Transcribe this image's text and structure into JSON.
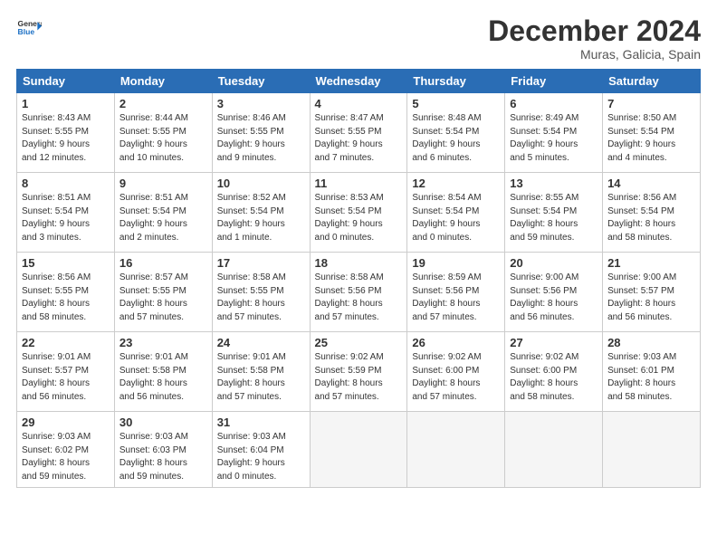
{
  "logo": {
    "line1": "General",
    "line2": "Blue"
  },
  "title": "December 2024",
  "location": "Muras, Galicia, Spain",
  "weekdays": [
    "Sunday",
    "Monday",
    "Tuesday",
    "Wednesday",
    "Thursday",
    "Friday",
    "Saturday"
  ],
  "weeks": [
    [
      {
        "day": "1",
        "info": "Sunrise: 8:43 AM\nSunset: 5:55 PM\nDaylight: 9 hours\nand 12 minutes."
      },
      {
        "day": "2",
        "info": "Sunrise: 8:44 AM\nSunset: 5:55 PM\nDaylight: 9 hours\nand 10 minutes."
      },
      {
        "day": "3",
        "info": "Sunrise: 8:46 AM\nSunset: 5:55 PM\nDaylight: 9 hours\nand 9 minutes."
      },
      {
        "day": "4",
        "info": "Sunrise: 8:47 AM\nSunset: 5:55 PM\nDaylight: 9 hours\nand 7 minutes."
      },
      {
        "day": "5",
        "info": "Sunrise: 8:48 AM\nSunset: 5:54 PM\nDaylight: 9 hours\nand 6 minutes."
      },
      {
        "day": "6",
        "info": "Sunrise: 8:49 AM\nSunset: 5:54 PM\nDaylight: 9 hours\nand 5 minutes."
      },
      {
        "day": "7",
        "info": "Sunrise: 8:50 AM\nSunset: 5:54 PM\nDaylight: 9 hours\nand 4 minutes."
      }
    ],
    [
      {
        "day": "8",
        "info": "Sunrise: 8:51 AM\nSunset: 5:54 PM\nDaylight: 9 hours\nand 3 minutes."
      },
      {
        "day": "9",
        "info": "Sunrise: 8:51 AM\nSunset: 5:54 PM\nDaylight: 9 hours\nand 2 minutes."
      },
      {
        "day": "10",
        "info": "Sunrise: 8:52 AM\nSunset: 5:54 PM\nDaylight: 9 hours\nand 1 minute."
      },
      {
        "day": "11",
        "info": "Sunrise: 8:53 AM\nSunset: 5:54 PM\nDaylight: 9 hours\nand 0 minutes."
      },
      {
        "day": "12",
        "info": "Sunrise: 8:54 AM\nSunset: 5:54 PM\nDaylight: 9 hours\nand 0 minutes."
      },
      {
        "day": "13",
        "info": "Sunrise: 8:55 AM\nSunset: 5:54 PM\nDaylight: 8 hours\nand 59 minutes."
      },
      {
        "day": "14",
        "info": "Sunrise: 8:56 AM\nSunset: 5:54 PM\nDaylight: 8 hours\nand 58 minutes."
      }
    ],
    [
      {
        "day": "15",
        "info": "Sunrise: 8:56 AM\nSunset: 5:55 PM\nDaylight: 8 hours\nand 58 minutes."
      },
      {
        "day": "16",
        "info": "Sunrise: 8:57 AM\nSunset: 5:55 PM\nDaylight: 8 hours\nand 57 minutes."
      },
      {
        "day": "17",
        "info": "Sunrise: 8:58 AM\nSunset: 5:55 PM\nDaylight: 8 hours\nand 57 minutes."
      },
      {
        "day": "18",
        "info": "Sunrise: 8:58 AM\nSunset: 5:56 PM\nDaylight: 8 hours\nand 57 minutes."
      },
      {
        "day": "19",
        "info": "Sunrise: 8:59 AM\nSunset: 5:56 PM\nDaylight: 8 hours\nand 57 minutes."
      },
      {
        "day": "20",
        "info": "Sunrise: 9:00 AM\nSunset: 5:56 PM\nDaylight: 8 hours\nand 56 minutes."
      },
      {
        "day": "21",
        "info": "Sunrise: 9:00 AM\nSunset: 5:57 PM\nDaylight: 8 hours\nand 56 minutes."
      }
    ],
    [
      {
        "day": "22",
        "info": "Sunrise: 9:01 AM\nSunset: 5:57 PM\nDaylight: 8 hours\nand 56 minutes."
      },
      {
        "day": "23",
        "info": "Sunrise: 9:01 AM\nSunset: 5:58 PM\nDaylight: 8 hours\nand 56 minutes."
      },
      {
        "day": "24",
        "info": "Sunrise: 9:01 AM\nSunset: 5:58 PM\nDaylight: 8 hours\nand 57 minutes."
      },
      {
        "day": "25",
        "info": "Sunrise: 9:02 AM\nSunset: 5:59 PM\nDaylight: 8 hours\nand 57 minutes."
      },
      {
        "day": "26",
        "info": "Sunrise: 9:02 AM\nSunset: 6:00 PM\nDaylight: 8 hours\nand 57 minutes."
      },
      {
        "day": "27",
        "info": "Sunrise: 9:02 AM\nSunset: 6:00 PM\nDaylight: 8 hours\nand 58 minutes."
      },
      {
        "day": "28",
        "info": "Sunrise: 9:03 AM\nSunset: 6:01 PM\nDaylight: 8 hours\nand 58 minutes."
      }
    ],
    [
      {
        "day": "29",
        "info": "Sunrise: 9:03 AM\nSunset: 6:02 PM\nDaylight: 8 hours\nand 59 minutes."
      },
      {
        "day": "30",
        "info": "Sunrise: 9:03 AM\nSunset: 6:03 PM\nDaylight: 8 hours\nand 59 minutes."
      },
      {
        "day": "31",
        "info": "Sunrise: 9:03 AM\nSunset: 6:04 PM\nDaylight: 9 hours\nand 0 minutes."
      },
      {
        "day": "",
        "info": ""
      },
      {
        "day": "",
        "info": ""
      },
      {
        "day": "",
        "info": ""
      },
      {
        "day": "",
        "info": ""
      }
    ]
  ]
}
